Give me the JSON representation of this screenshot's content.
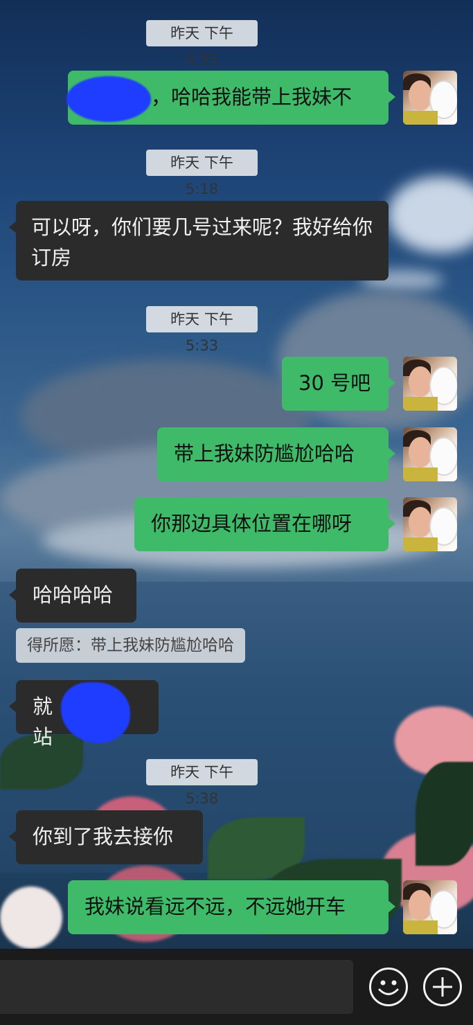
{
  "messages": [
    {
      "type": "timestamp",
      "text": "昨天 下午4:55"
    },
    {
      "type": "out",
      "text": "，哈哈我能带上我妹不"
    },
    {
      "type": "timestamp",
      "text": "昨天 下午5:18"
    },
    {
      "type": "in",
      "text": "可以呀，你们要几号过来呢？我好给你订房"
    },
    {
      "type": "timestamp",
      "text": "昨天 下午5:33"
    },
    {
      "type": "out",
      "text": "30 号吧"
    },
    {
      "type": "out",
      "text": "带上我妹防尴尬哈哈"
    },
    {
      "type": "out",
      "text": "你那边具体位置在哪呀"
    },
    {
      "type": "in",
      "text": "哈哈哈哈"
    },
    {
      "type": "quote",
      "text": "得所愿：带上我妹防尴尬哈哈"
    },
    {
      "type": "in",
      "text": "就是站"
    },
    {
      "type": "timestamp",
      "text": "昨天 下午5:38"
    },
    {
      "type": "in",
      "text": "你到了我去接你"
    },
    {
      "type": "out",
      "text": "我妹说看远不远，不远她开车"
    }
  ],
  "input_bar": {
    "emoji_icon": "smiley-face-icon",
    "plus_icon": "plus-icon"
  }
}
